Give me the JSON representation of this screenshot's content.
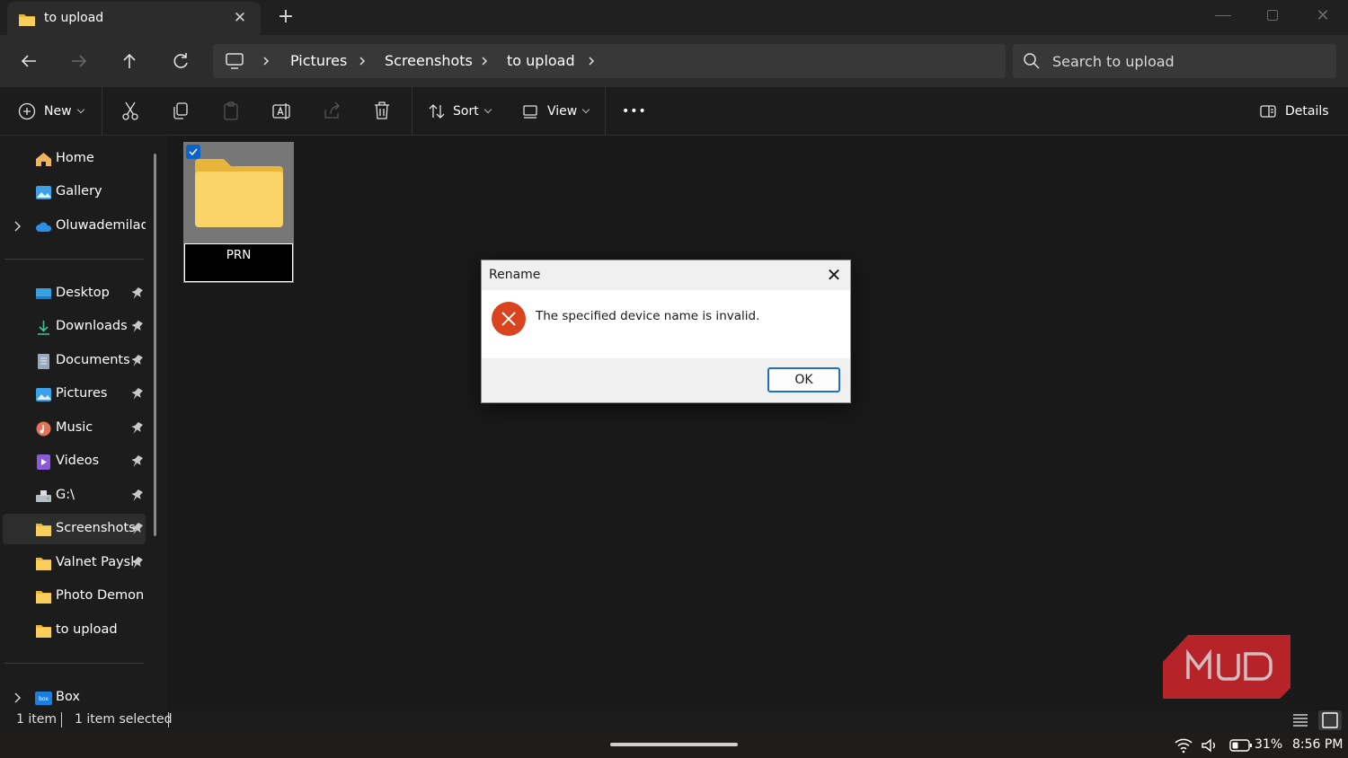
{
  "tab": {
    "title": "to upload",
    "close_label": "✕",
    "new_tab_label": "+"
  },
  "window_controls": {
    "close_label": "✕"
  },
  "breadcrumbs": [
    "Pictures",
    "Screenshots",
    "to upload"
  ],
  "search": {
    "placeholder": "Search to upload"
  },
  "toolbar": {
    "new_label": "New",
    "sort_label": "Sort",
    "view_label": "View",
    "more_label": "•••",
    "details_label": "Details"
  },
  "sidebar": {
    "items": [
      {
        "label": "Home",
        "icon": "home-icon"
      },
      {
        "label": "Gallery",
        "icon": "gallery-icon"
      },
      {
        "label": "Oluwademilade",
        "icon": "onedrive-cloud-icon"
      },
      {
        "label": "Desktop",
        "icon": "desktop-icon"
      },
      {
        "label": "Downloads",
        "icon": "downloads-icon"
      },
      {
        "label": "Documents",
        "icon": "documents-icon"
      },
      {
        "label": "Pictures",
        "icon": "pictures-icon"
      },
      {
        "label": "Music",
        "icon": "music-icon"
      },
      {
        "label": "Videos",
        "icon": "videos-icon"
      },
      {
        "label": "G:\\",
        "icon": "drive-icon"
      },
      {
        "label": "Screenshots",
        "icon": "folder-icon"
      },
      {
        "label": "Valnet Payslip",
        "icon": "folder-icon"
      },
      {
        "label": "Photo Demon",
        "icon": "folder-icon"
      },
      {
        "label": "to upload",
        "icon": "folder-icon"
      },
      {
        "label": "Box",
        "icon": "box-icon"
      }
    ]
  },
  "content": {
    "items": [
      {
        "name": "PRN",
        "selected": true
      }
    ]
  },
  "status": {
    "count": "1 item",
    "selection": "1 item selected"
  },
  "tray": {
    "battery": "31%",
    "time": "8:56 PM"
  },
  "dialog": {
    "title": "Rename",
    "message": "The specified device name is invalid.",
    "ok_label": "OK",
    "close_label": "✕",
    "icon": "error-icon"
  },
  "watermark": {
    "text": "MUO"
  },
  "colors": {
    "accent": "#1f6fc8",
    "error": "#d9441f",
    "folder": "#f8cf5a",
    "background": "#191919"
  }
}
